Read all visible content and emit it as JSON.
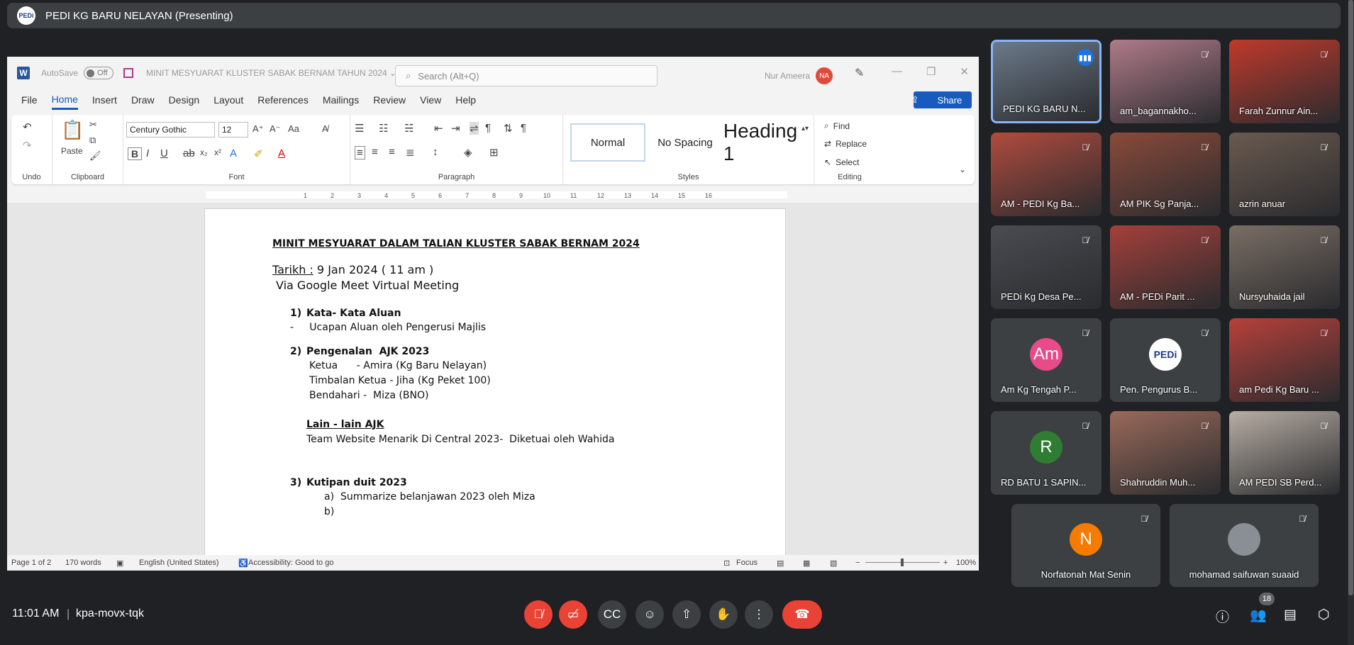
{
  "presenting_bar": {
    "logo_text": "PEDi",
    "title": "PEDI KG BARU NELAYAN (Presenting)"
  },
  "word": {
    "autosave_label": "AutoSave",
    "autosave_state": "Off",
    "doc_title": "MINIT MESYUARAT KLUSTER SABAK BERNAM TAHUN 2024 ⌄",
    "search_placeholder": "Search (Alt+Q)",
    "user_name": "Nur Ameera",
    "user_initials": "NA",
    "menus": [
      "File",
      "Home",
      "Insert",
      "Draw",
      "Design",
      "Layout",
      "References",
      "Mailings",
      "Review",
      "View",
      "Help"
    ],
    "active_menu": "Home",
    "share_label": "Share",
    "ribbon": {
      "undo_label": "Undo",
      "clipboard_label": "Clipboard",
      "paste_label": "Paste",
      "font_label": "Font",
      "font_name": "Century Gothic",
      "font_size": "12",
      "paragraph_label": "Paragraph",
      "styles_label": "Styles",
      "style_normal": "Normal",
      "style_nospacing": "No Spacing",
      "style_heading": "Heading 1",
      "editing_label": "Editing",
      "find": "Find",
      "replace": "Replace",
      "select": "Select"
    },
    "ruler_numbers": [
      "1",
      "2",
      "3",
      "4",
      "5",
      "6",
      "7",
      "8",
      "9",
      "10",
      "11",
      "12",
      "13",
      "14",
      "15",
      "16"
    ],
    "document": {
      "heading": "MINIT MESYUARAT DALAM TALIAN KLUSTER SABAK BERNAM 2024",
      "date_label": "Tarikh :",
      "date_value": " 9 Jan 2024 ( 11 am )",
      "venue": "Via Google Meet Virtual Meeting",
      "s1_num": "1)",
      "s1_title": "Kata- Kata Aluan",
      "s1_item": "-     Ucapan Aluan oleh Pengerusi Majlis",
      "s2_num": "2)",
      "s2_title": "Pengenalan  AJK 2023",
      "s2_l1": "Ketua      - Amira (Kg Baru Nelayan)",
      "s2_l2": "Timbalan Ketua - Jiha (Kg Peket 100)",
      "s2_l3": "Bendahari -  Miza (BNO)",
      "s2_sub": "Lain - lain AJK",
      "s2_l4": "Team Website Menarik Di Central 2023-  Diketuai oleh Wahida",
      "s3_num": "3)",
      "s3_title": "Kutipan duit 2023",
      "s3_a": "a)  Summarize belanjawan 2023 oleh Miza",
      "s3_b": "b)"
    },
    "status": {
      "page": "Page 1 of 2",
      "words": "170 words",
      "language": "English (United States)",
      "accessibility": "Accessibility: Good to go",
      "focus": "Focus",
      "zoom": "100%"
    }
  },
  "participants": [
    {
      "name": "PEDI KG BARU N...",
      "bg": "#6b7a8a",
      "speaking": true
    },
    {
      "name": "am_bagannakho...",
      "bg": "#b07b8a"
    },
    {
      "name": "Farah Zunnur Ain...",
      "bg": "#c0392b"
    },
    {
      "name": "AM - PEDI Kg Ba...",
      "bg": "#b14b3e"
    },
    {
      "name": "AM PIK Sg Panja...",
      "bg": "#8a4a3a"
    },
    {
      "name": "azrin anuar",
      "bg": "#6a5a4e"
    },
    {
      "name": "PEDi Kg Desa Pe...",
      "bg": "#4a4c52"
    },
    {
      "name": "AM - PEDi Parit ...",
      "bg": "#a4403a"
    },
    {
      "name": "Nursyuhaida jail",
      "bg": "#7a6e64"
    },
    {
      "name": "Am Kg Tengah P...",
      "bg": "#3c4043",
      "avatar": "Am",
      "avatar_color": "#e84a8a"
    },
    {
      "name": "Pen. Pengurus B...",
      "bg": "#3c4043",
      "avatar": "PEDi",
      "avatar_color": "#ffffff"
    },
    {
      "name": "am Pedi Kg Baru ...",
      "bg": "#b8403a"
    },
    {
      "name": "RD BATU 1 SAPIN...",
      "bg": "#3c4043",
      "avatar": "R",
      "avatar_color": "#2e7d32"
    },
    {
      "name": "Shahruddin Muh...",
      "bg": "#9a6a5a"
    },
    {
      "name": "AM PEDI SB Perd...",
      "bg": "#b8aea4"
    },
    {
      "name": "Norfatonah Mat Senin",
      "bg": "#3c4043",
      "avatar": "N",
      "avatar_color": "#f57c00"
    },
    {
      "name": "mohamad saifuwan suaaid",
      "bg": "#3c4043",
      "avatar": "photo",
      "avatar_color": "#8a8f96"
    }
  ],
  "bottom": {
    "time": "11:01 AM",
    "separator": "|",
    "meeting_code": "kpa-movx-tqk",
    "participant_count": "18"
  }
}
